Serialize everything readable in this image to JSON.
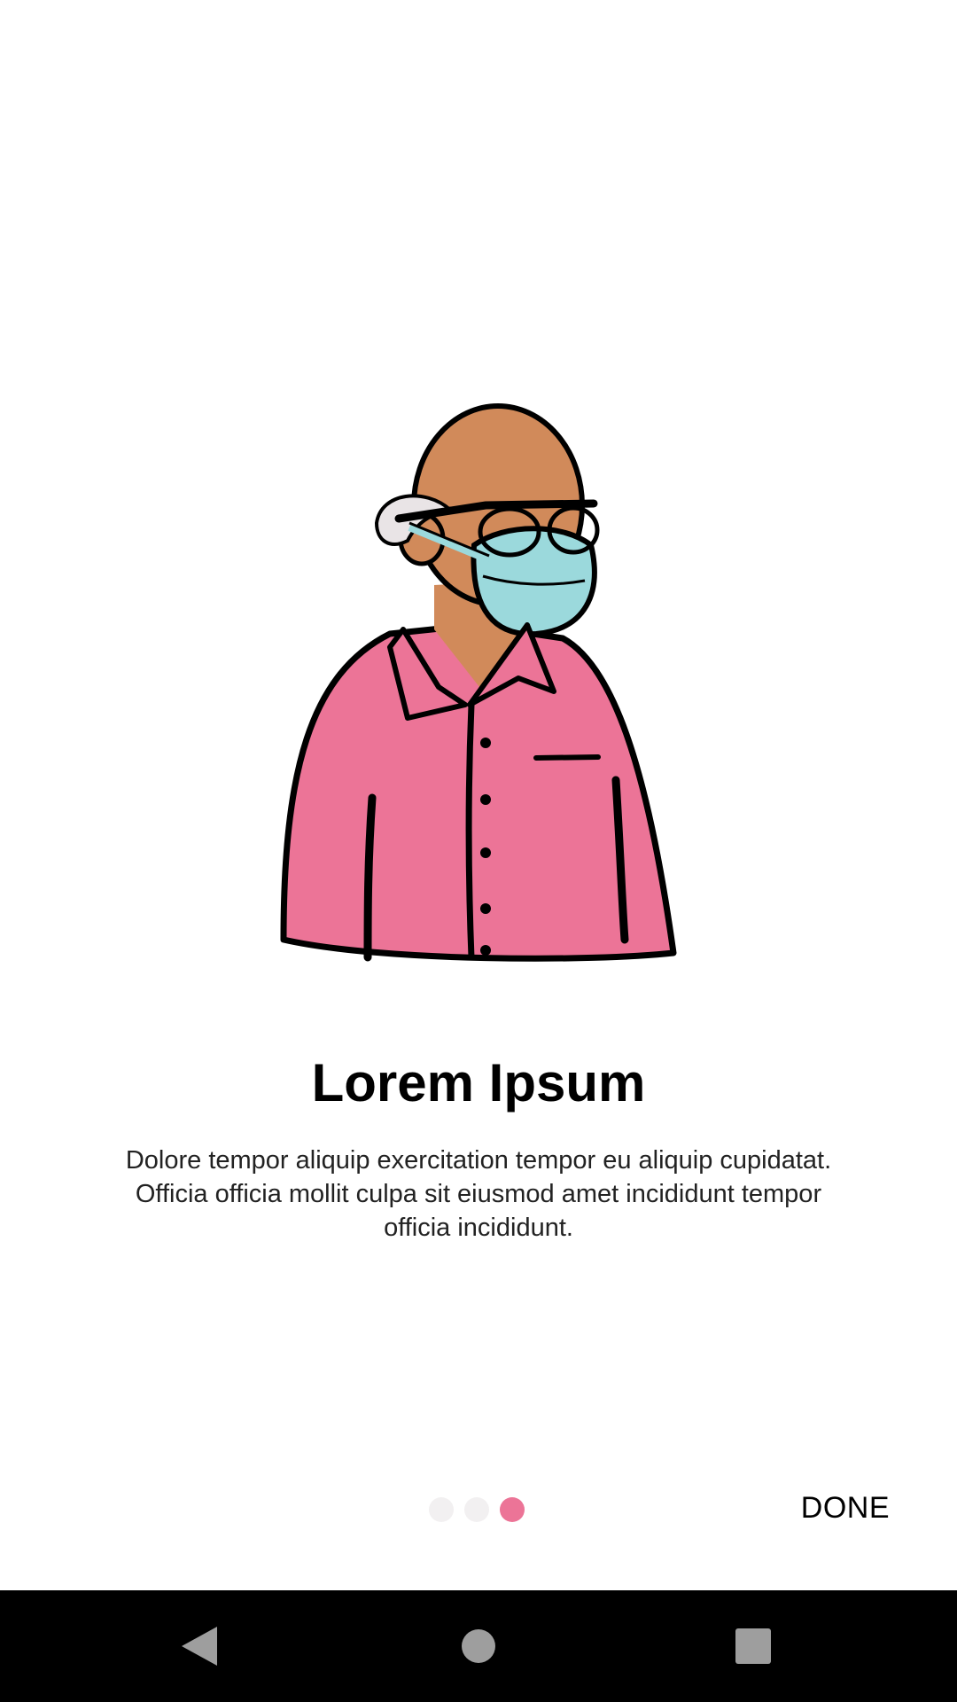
{
  "onboarding": {
    "title": "Lorem Ipsum",
    "description": "Dolore tempor aliquip exercitation tempor eu aliquip cupidatat. Officia officia mollit culpa sit eiusmod amet incididunt tempor officia incididunt.",
    "illustration": "person-with-face-mask-illustration",
    "pager": {
      "total": 3,
      "current": 3
    },
    "done_label": "DONE"
  },
  "colors": {
    "accent": "#ec7497",
    "dot_inactive": "#f2f0f1",
    "shirt": "#ec7497",
    "skin": "#d18a5a",
    "mask": "#9bd9dc"
  },
  "nav_bar": {
    "back_icon": "back-triangle-icon",
    "home_icon": "home-circle-icon",
    "recents_icon": "recents-square-icon"
  }
}
